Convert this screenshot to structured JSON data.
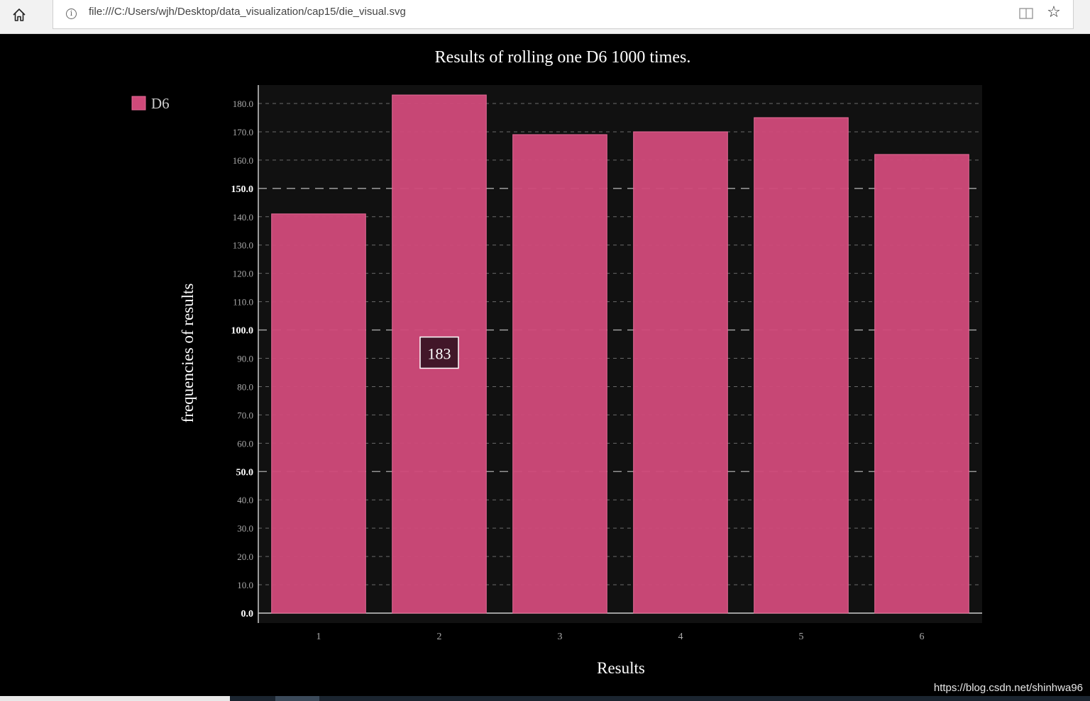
{
  "browser": {
    "url": "file:///C:/Users/wjh/Desktop/data_visualization/cap15/die_visual.svg"
  },
  "colors": {
    "bar": "#cf4a7a",
    "plot_background": "#111111",
    "page_background": "#000000",
    "text": "#ffffff"
  },
  "chart_data": {
    "type": "bar",
    "title": "Results of rolling one D6 1000 times.",
    "xlabel": "Results",
    "ylabel": "frequencies of results",
    "categories": [
      "1",
      "2",
      "3",
      "4",
      "5",
      "6"
    ],
    "series": [
      {
        "name": "D6",
        "values": [
          141,
          183,
          169,
          170,
          175,
          162
        ]
      }
    ],
    "ylim": [
      0,
      186.5
    ],
    "yticks": [
      "0.0",
      "10.0",
      "20.0",
      "30.0",
      "40.0",
      "50.0",
      "60.0",
      "70.0",
      "80.0",
      "90.0",
      "100.0",
      "110.0",
      "120.0",
      "130.0",
      "140.0",
      "150.0",
      "160.0",
      "170.0",
      "180.0"
    ],
    "major_yticks": [
      "0.0",
      "50.0",
      "100.0",
      "150.0"
    ],
    "grid": true,
    "legend": "top-left",
    "tooltip": {
      "category": "2",
      "value": "183"
    }
  },
  "watermark": "https://blog.csdn.net/shinhwa96"
}
